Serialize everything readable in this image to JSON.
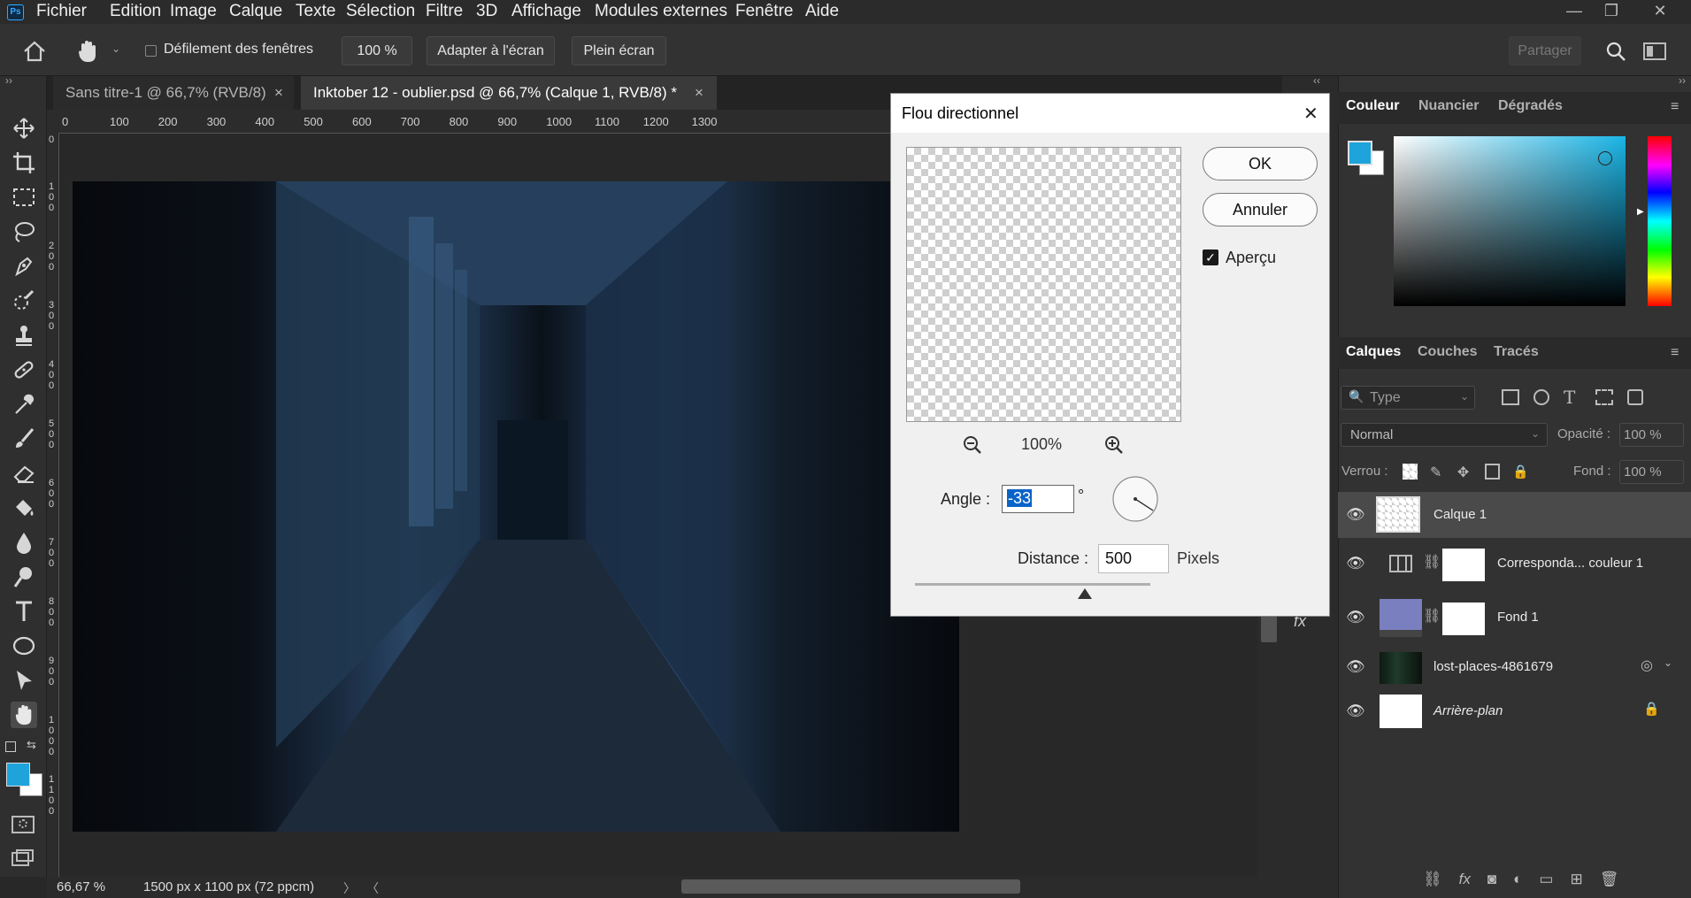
{
  "app": {
    "logo": "Ps"
  },
  "menu": [
    "Fichier",
    "Edition",
    "Image",
    "Calque",
    "Texte",
    "Sélection",
    "Filtre",
    "3D",
    "Affichage",
    "Modules externes",
    "Fenêtre",
    "Aide"
  ],
  "window_controls": {
    "minimize": "—",
    "restore": "❐",
    "close": "✕"
  },
  "options_bar": {
    "scroll_all_label": "Défilement des fenêtres",
    "zoom_value": "100 %",
    "fit_screen": "Adapter à l'écran",
    "full_screen": "Plein écran",
    "share": "Partager"
  },
  "tabs": [
    {
      "title": "Sans titre-1 @ 66,7% (RVB/8)",
      "active": false
    },
    {
      "title": "Inktober 12 - oublier.psd @ 66,7% (Calque 1, RVB/8) *",
      "active": true
    }
  ],
  "tab_close": "×",
  "ruler": {
    "top_ticks": [
      "0",
      "100",
      "200",
      "300",
      "400",
      "500",
      "600",
      "700",
      "800",
      "900",
      "1000",
      "1100",
      "1200",
      "1300"
    ],
    "left_ticks": [
      "0",
      "100",
      "200",
      "300",
      "400",
      "500",
      "600",
      "700",
      "800",
      "900",
      "1000",
      "1100"
    ]
  },
  "status": {
    "zoom": "66,67 %",
    "doc_info": "1500 px x 1100 px (72 ppcm)",
    "nav_next": "〉",
    "nav_prev": "〈"
  },
  "dialog": {
    "title": "Flou directionnel",
    "ok": "OK",
    "cancel": "Annuler",
    "preview_label": "Aperçu",
    "preview_checked": true,
    "zoom_level": "100%",
    "angle_label": "Angle :",
    "angle_value": "-33",
    "degree_symbol": "°",
    "distance_label": "Distance :",
    "distance_value": "500",
    "distance_unit": "Pixels",
    "distance_slider_fraction": 0.72,
    "close": "✕"
  },
  "color_panel": {
    "tabs": [
      "Couleur",
      "Nuancier",
      "Dégradés"
    ],
    "foreground": "#1ea3db",
    "background": "#ffffff",
    "hue_color": "#1ab5e6"
  },
  "layers_panel": {
    "tabs": [
      "Calques",
      "Couches",
      "Tracés"
    ],
    "filter_placeholder": "Type",
    "blend_mode": "Normal",
    "opacity_label": "Opacité :",
    "opacity_value": "100 %",
    "lock_label": "Verrou :",
    "fill_label": "Fond :",
    "fill_value": "100 %",
    "layers": [
      {
        "name": "Calque 1",
        "selected": true,
        "thumb": "checker",
        "mask": false
      },
      {
        "name": "Correspondа... couleur 1",
        "selected": false,
        "thumb": "grid",
        "mask": true
      },
      {
        "name": "Fond 1",
        "selected": false,
        "thumb": "#7a7fbf",
        "mask": true
      },
      {
        "name": "lost-places-4861679",
        "selected": false,
        "thumb": "photo",
        "mask": false
      },
      {
        "name": "Arrière-plan",
        "selected": false,
        "thumb": "#ffffff",
        "mask": false,
        "italic": true
      }
    ]
  },
  "fx_label": "fx"
}
